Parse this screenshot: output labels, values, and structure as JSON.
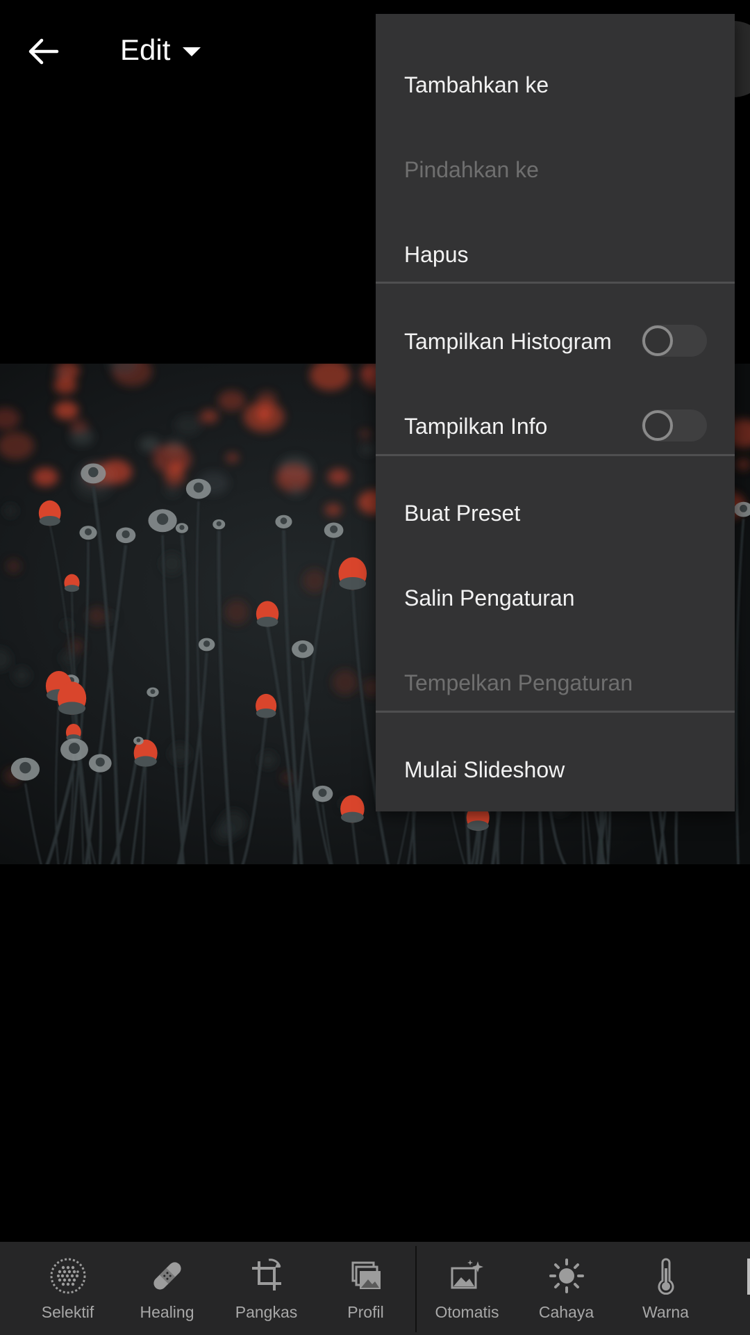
{
  "header": {
    "back_icon": "arrow-left-icon",
    "mode_label": "Edit",
    "mode_icon": "caret-down-icon"
  },
  "menu": {
    "items": [
      {
        "label": "Tambahkan ke",
        "enabled": true
      },
      {
        "label": "Pindahkan ke",
        "enabled": false
      },
      {
        "label": "Hapus",
        "enabled": true
      },
      {
        "label": "Tampilkan Histogram",
        "enabled": true,
        "toggle": false
      },
      {
        "label": "Tampilkan Info",
        "enabled": true,
        "toggle": false
      },
      {
        "label": "Buat Preset",
        "enabled": true
      },
      {
        "label": "Salin Pengaturan",
        "enabled": true
      },
      {
        "label": "Tempelkan Pengaturan",
        "enabled": false
      },
      {
        "label": "Mulai Slideshow",
        "enabled": true
      }
    ]
  },
  "toolbar": {
    "tools": [
      {
        "label": "Selektif",
        "icon": "selective-dots-icon"
      },
      {
        "label": "Healing",
        "icon": "bandage-icon"
      },
      {
        "label": "Pangkas",
        "icon": "crop-rotate-icon"
      },
      {
        "label": "Profil",
        "icon": "profile-stack-icon"
      },
      {
        "label": "Otomatis",
        "icon": "auto-image-sparkle-icon"
      },
      {
        "label": "Cahaya",
        "icon": "sun-icon"
      },
      {
        "label": "Warna",
        "icon": "thermometer-icon"
      }
    ]
  },
  "colors": {
    "background": "#000000",
    "menu_bg": "#333334",
    "menu_text": "#f2f2f2",
    "menu_text_disabled": "#6f6f6f",
    "toolbar_bg": "#262627",
    "toolbar_text": "#a8a8a8",
    "flower_accent": "#d9452c"
  }
}
